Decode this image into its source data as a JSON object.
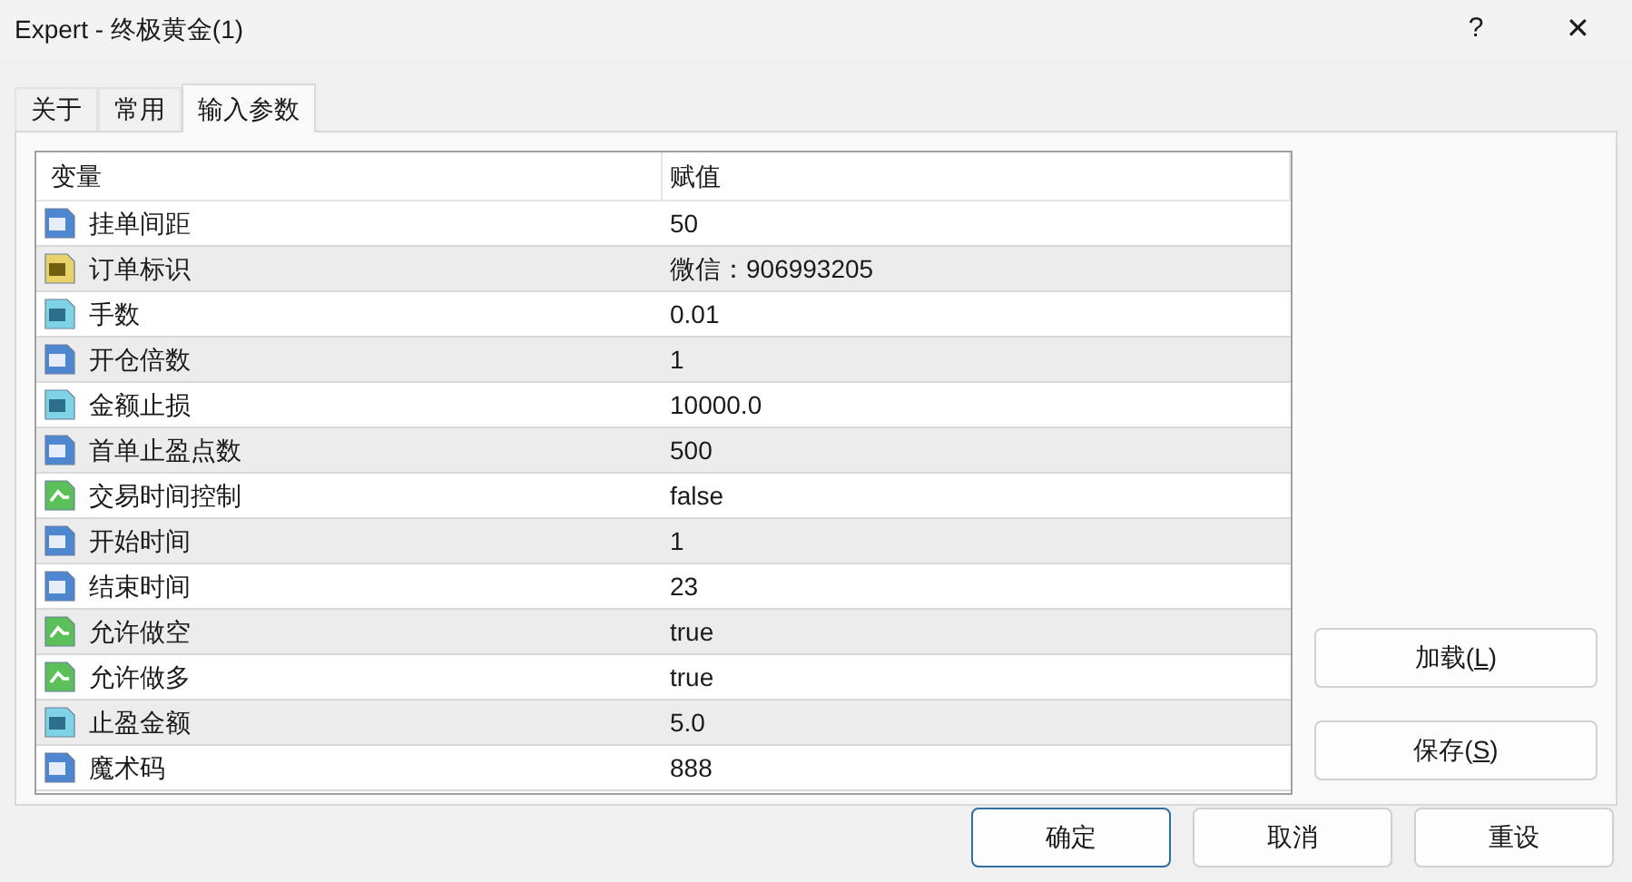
{
  "window": {
    "title": "Expert - 终极黄金(1)",
    "help": "?",
    "close": "✕"
  },
  "tabs": [
    {
      "label": "关于",
      "selected": false
    },
    {
      "label": "常用",
      "selected": false
    },
    {
      "label": "输入参数",
      "selected": true
    }
  ],
  "table": {
    "columns": [
      "变量",
      "赋值"
    ],
    "rows": [
      {
        "kind": "int",
        "name": "挂单间距",
        "value": "50"
      },
      {
        "kind": "string",
        "name": "订单标识",
        "value": "微信：906993205"
      },
      {
        "kind": "double",
        "name": "手数",
        "value": "0.01"
      },
      {
        "kind": "int",
        "name": "开仓倍数",
        "value": "1"
      },
      {
        "kind": "double",
        "name": "金额止损",
        "value": "10000.0"
      },
      {
        "kind": "int",
        "name": "首单止盈点数",
        "value": "500"
      },
      {
        "kind": "bool",
        "name": "交易时间控制",
        "value": "false"
      },
      {
        "kind": "int",
        "name": "开始时间",
        "value": "1"
      },
      {
        "kind": "int",
        "name": "结束时间",
        "value": "23"
      },
      {
        "kind": "bool",
        "name": "允许做空",
        "value": "true"
      },
      {
        "kind": "bool",
        "name": "允许做多",
        "value": "true"
      },
      {
        "kind": "double",
        "name": "止盈金额",
        "value": "5.0"
      },
      {
        "kind": "int",
        "name": "魔术码",
        "value": "888"
      }
    ]
  },
  "side_buttons": [
    {
      "label": "加载(",
      "key": "L",
      "end": ")"
    },
    {
      "label": "保存(",
      "key": "S",
      "end": ")"
    }
  ],
  "buttons": [
    {
      "label": "确定",
      "default": true
    },
    {
      "label": "取消",
      "default": false
    },
    {
      "label": "重设",
      "default": false
    }
  ]
}
